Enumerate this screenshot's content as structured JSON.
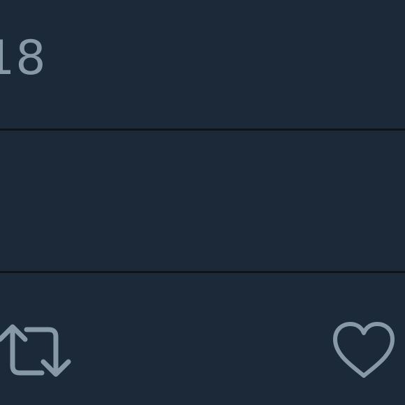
{
  "tweet_detail": {
    "timestamp_fragment": "18"
  },
  "actions": {
    "retweet_icon": "retweet-icon",
    "like_icon": "heart-icon"
  },
  "colors": {
    "background": "#1c2938",
    "divider": "#0d141c",
    "icon": "#8899a6",
    "text": "#8899a6"
  }
}
